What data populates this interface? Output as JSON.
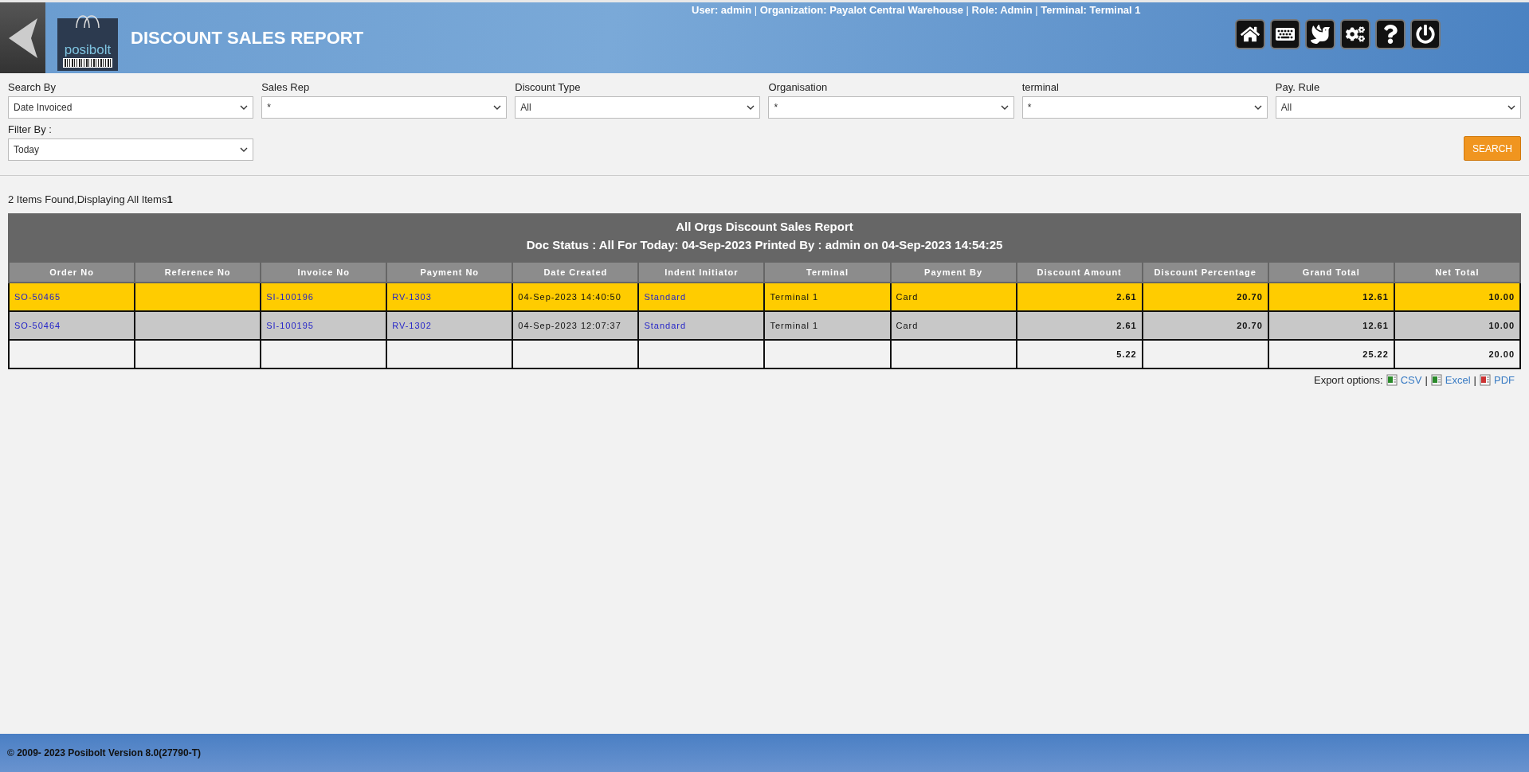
{
  "header": {
    "title": "DISCOUNT SALES REPORT",
    "logo_text": "posibolt",
    "user_info": "**User: admin** | **Organization: Payalot Central Warehouse** | **Role: Admin** | **Terminal: Terminal 1**"
  },
  "filters": [
    {
      "label": "Search By",
      "value": "Date Invoiced"
    },
    {
      "label": "Sales Rep",
      "value": "*"
    },
    {
      "label": "Discount Type",
      "value": "All"
    },
    {
      "label": "Organisation",
      "value": "*"
    },
    {
      "label": "terminal",
      "value": "*"
    },
    {
      "label": "Pay. Rule",
      "value": "All"
    },
    {
      "label": "Filter By :",
      "value": "Today"
    }
  ],
  "search_button": "SEARCH",
  "result_summary": "2 Items Found,Displaying All Items**1**",
  "report": {
    "title": "All Orgs Discount Sales Report",
    "subtitle": "Doc Status : All For Today: 04-Sep-2023 Printed By : admin on 04-Sep-2023 14:54:25",
    "columns": [
      {
        "label": "Order No",
        "kind": "link"
      },
      {
        "label": "Reference No",
        "kind": "text"
      },
      {
        "label": "Invoice No",
        "kind": "link"
      },
      {
        "label": "Payment No",
        "kind": "link"
      },
      {
        "label": "Date Created",
        "kind": "text"
      },
      {
        "label": "Indent Initiator",
        "kind": "link"
      },
      {
        "label": "Terminal",
        "kind": "text"
      },
      {
        "label": "Payment By",
        "kind": "text"
      },
      {
        "label": "Discount Amount",
        "kind": "number",
        "total": "5.22"
      },
      {
        "label": "Discount Percentage",
        "kind": "number"
      },
      {
        "label": "Grand Total",
        "kind": "number",
        "total": "25.22"
      },
      {
        "label": "Net Total",
        "kind": "number",
        "total": "20.00"
      }
    ],
    "rows": [
      {
        "selected": true,
        "cells": [
          "SO-50465",
          "",
          "SI-100196",
          "RV-1303",
          "04-Sep-2023 14:40:50",
          "Standard",
          "Terminal 1",
          "Card",
          "2.61",
          "20.70",
          "12.61",
          "10.00"
        ]
      },
      {
        "selected": false,
        "cells": [
          "SO-50464",
          "",
          "SI-100195",
          "RV-1302",
          "04-Sep-2023 12:07:37",
          "Standard",
          "Terminal 1",
          "Card",
          "2.61",
          "20.70",
          "12.61",
          "10.00"
        ]
      }
    ],
    "has_totals": true
  },
  "export": {
    "label": "Export options:",
    "separator": "|",
    "options": [
      {
        "label": "CSV",
        "kind": "csv"
      },
      {
        "label": "Excel",
        "kind": "excel"
      },
      {
        "label": "PDF",
        "kind": "pdf"
      }
    ]
  },
  "footer": "© 2009- 2023 Posibolt Version  8.0(27790-T)"
}
